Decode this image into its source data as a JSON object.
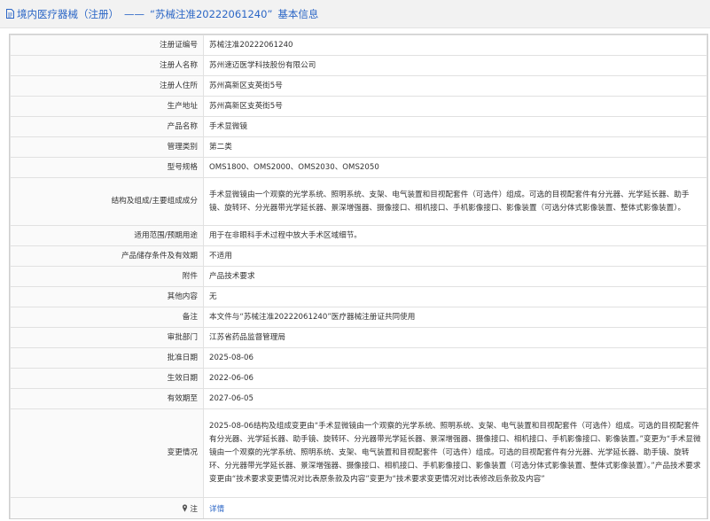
{
  "header": {
    "category": "境内医疗器械（注册）",
    "separator": "——",
    "reg_no_quoted": "“苏械注准20222061240”",
    "suffix": "基本信息"
  },
  "rows": [
    {
      "label": "注册证编号",
      "value": "苏械注准20222061240"
    },
    {
      "label": "注册人名称",
      "value": "苏州速迈医学科技股份有限公司"
    },
    {
      "label": "注册人住所",
      "value": "苏州高新区支英街5号"
    },
    {
      "label": "生产地址",
      "value": "苏州高新区支英街5号"
    },
    {
      "label": "产品名称",
      "value": "手术显微镜"
    },
    {
      "label": "管理类别",
      "value": "第二类"
    },
    {
      "label": "型号规格",
      "value": "OMS1800、OMS2000、OMS2030、OMS2050"
    },
    {
      "label": "结构及组成/主要组成成分",
      "value": "手术显微镜由一个观察的光学系统、照明系统、支架、电气装置和目视配套件（可选件）组成。可选的目视配套件有分光器、光学延长器、助手镜、旋转环、分光器带光学延长器、景深增强器、摄像接口、相机接口、手机影像接口、影像装置（可选分体式影像装置、整体式影像装置）。"
    },
    {
      "label": "适用范围/预期用途",
      "value": "用于在非眼科手术过程中放大手术区域细节。"
    },
    {
      "label": "产品储存条件及有效期",
      "value": "不适用"
    },
    {
      "label": "附件",
      "value": "产品技术要求"
    },
    {
      "label": "其他内容",
      "value": "无"
    },
    {
      "label": "备注",
      "value": "本文件与“苏械注准20222061240”医疗器械注册证共同使用"
    },
    {
      "label": "审批部门",
      "value": "江苏省药品监督管理局"
    },
    {
      "label": "批准日期",
      "value": "2025-08-06"
    },
    {
      "label": "生效日期",
      "value": "2022-06-06"
    },
    {
      "label": "有效期至",
      "value": "2027-06-05"
    },
    {
      "label": "变更情况",
      "value": "2025-08-06结构及组成变更由“手术显微镜由一个观察的光学系统、照明系统、支架、电气装置和目视配套件（可选件）组成。可选的目视配套件有分光器、光学延长器、助手镜、旋转环、分光器带光学延长器、景深增强器、摄像接口、相机接口、手机影像接口、影像装置。”变更为“手术显微镜由一个观察的光学系统、照明系统、支架、电气装置和目视配套件（可选件）组成。可选的目视配套件有分光器、光学延长器、助手镜、旋转环、分光器带光学延长器、景深增强器、摄像接口、相机接口、手机影像接口、影像装置（可选分体式影像装置、整体式影像装置）。”产品技术要求变更由“技术要求变更情况对比表原条款及内容”变更为“技术要求变更情况对比表修改后条款及内容”"
    }
  ],
  "note_row": {
    "label": "注",
    "link_text": "详情"
  }
}
